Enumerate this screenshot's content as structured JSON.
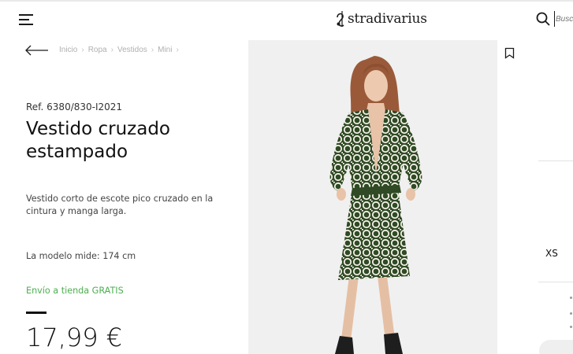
{
  "header": {
    "menu_icon": "hamburger-menu-icon",
    "logo_text": "stradivarius",
    "search_icon": "search-icon",
    "search_placeholder": "Busca"
  },
  "breadcrumb": {
    "back_icon": "arrow-left-icon",
    "items": [
      "Inicio",
      "Ropa",
      "Vestidos",
      "Mini"
    ]
  },
  "product": {
    "ref": "Ref. 6380/830-I2021",
    "title": "Vestido cruzado estampado",
    "description": "Vestido corto de escote pico cruzado en la cintura y manga larga.",
    "model_info": "La modelo mide: 174 cm",
    "shipping": "Envío a tienda GRATIS",
    "price": "17,99 €",
    "bookmark_icon": "bookmark-icon"
  },
  "right_panel": {
    "size_label": "XS"
  },
  "colors": {
    "shipping_green": "#4caf50",
    "dress_green": "#3d5a2f",
    "photo_bg": "#f0f0f0"
  }
}
